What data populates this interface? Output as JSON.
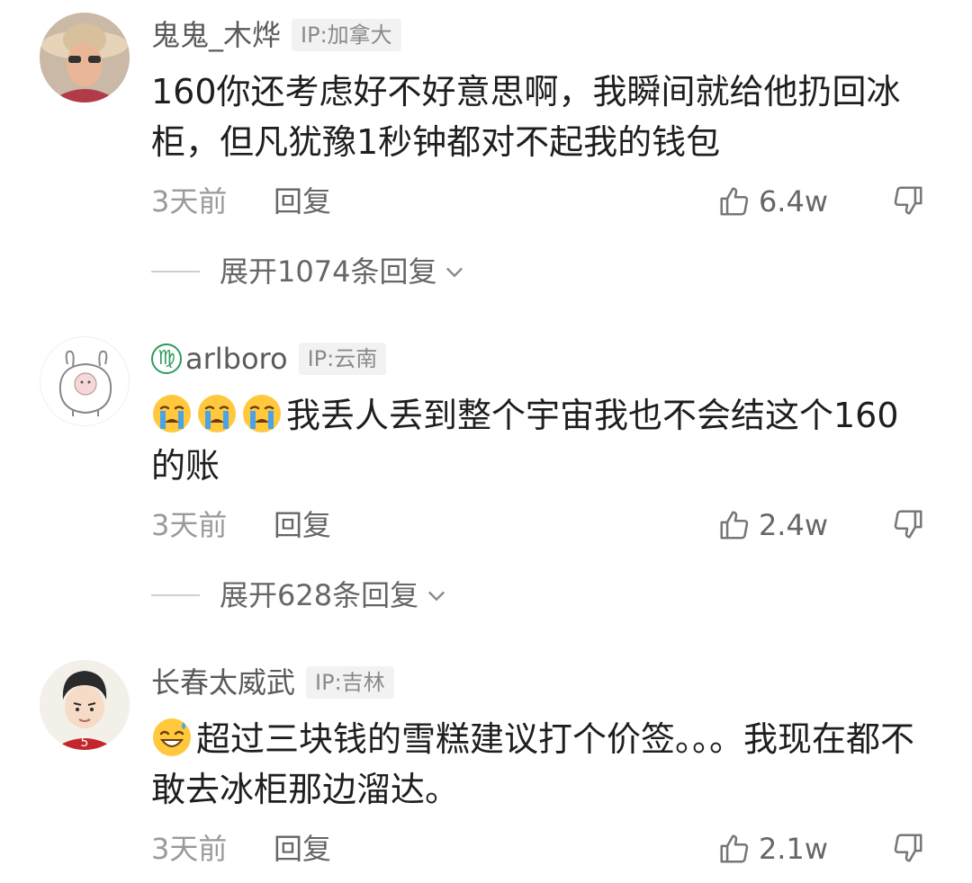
{
  "comments": [
    {
      "username": "鬼鬼_木烨",
      "ip": "IP:加拿大",
      "content": "160你还考虑好不好意思啊，我瞬间就给他扔回冰柜，但凡犹豫1秒钟都对不起我的钱包",
      "time": "3天前",
      "reply_label": "回复",
      "likes": "6.4w",
      "expand_label": "展开1074条回复"
    },
    {
      "username": "arlboro",
      "username_prefix_icon": "virgo-icon",
      "ip": "IP:云南",
      "emojis": [
        "crying-face-emoji",
        "crying-face-emoji",
        "crying-face-emoji"
      ],
      "content": "我丢人丢到整个宇宙我也不会结这个160的账",
      "time": "3天前",
      "reply_label": "回复",
      "likes": "2.4w",
      "expand_label": "展开628条回复"
    },
    {
      "username": "长春太威武",
      "ip": "IP:吉林",
      "emojis": [
        "grinning-sweat-emoji"
      ],
      "content": "超过三块钱的雪糕建议打个价签。。。我现在都不敢去冰柜那边溜达。",
      "time": "3天前",
      "reply_label": "回复",
      "likes": "2.1w"
    }
  ],
  "colors": {
    "text_primary": "#1e1e1e",
    "text_secondary": "#9a9a9a",
    "badge_bg": "#f2f2f2",
    "emoji_yellow": "#ffc83d",
    "emoji_tears": "#4aa3e8"
  }
}
